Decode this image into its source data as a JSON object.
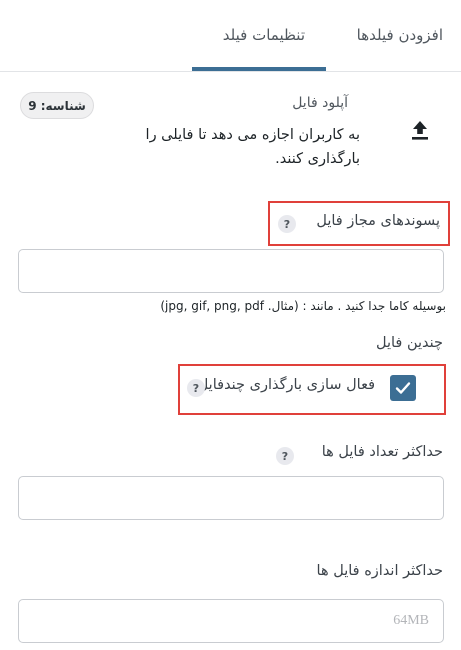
{
  "tabs": {
    "add_fields": "افزودن فیلدها",
    "field_settings": "تنظیمات فیلد"
  },
  "field": {
    "icon": "upload-icon",
    "title": "آپلود فایل",
    "description": "به کاربران اجازه می دهد تا فایلی را بارگذاری کنند.",
    "id_badge": "شناسه: 9"
  },
  "allowed_extensions": {
    "label": "پسوندهای مجاز فایل",
    "help": "?",
    "value": "",
    "hint": "بوسیله کاما جدا کنید . مانند : (مثال. jpg, gif, png, pdf)"
  },
  "multiple_files": {
    "section_label": "چندین فایل",
    "checkbox_label": "فعال سازی بارگذاری چندفایل",
    "checked": true,
    "help": "?"
  },
  "max_files": {
    "label": "حداکثر تعداد فایل ها",
    "help": "?",
    "value": ""
  },
  "max_file_size": {
    "label": "حداکثر اندازه فایل ها",
    "placeholder": "64MB",
    "value": ""
  },
  "colors": {
    "accent": "#3c6e94",
    "highlight": "#e0403a",
    "border": "#c9ccd1"
  }
}
